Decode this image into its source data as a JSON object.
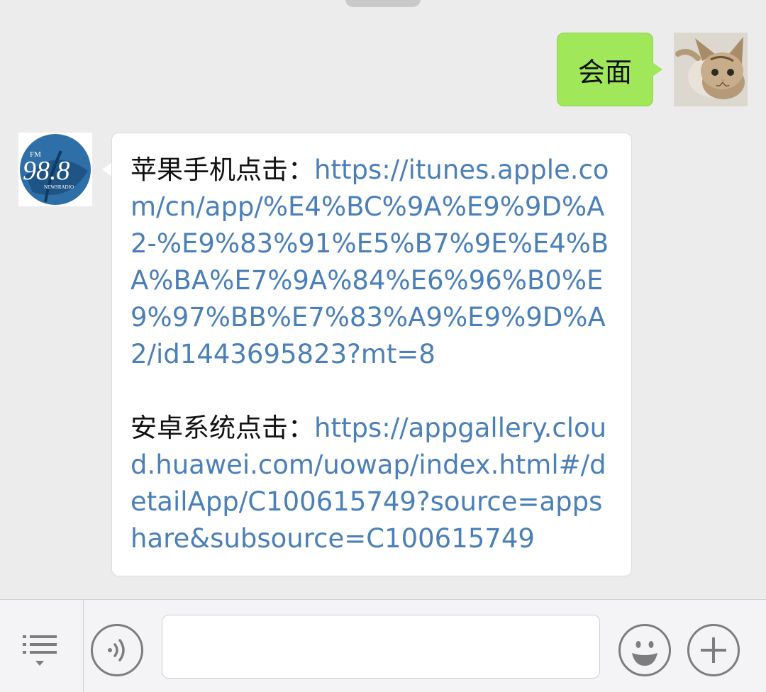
{
  "colors": {
    "chat_background": "#ececec",
    "outgoing_bubble": "#a0e75a",
    "incoming_bubble": "#ffffff",
    "link": "#4a7fb8",
    "icon_stroke": "#7d7d7f"
  },
  "outgoing_message": {
    "text": "会面",
    "avatar_icon": "cat-avatar-icon"
  },
  "incoming_message": {
    "avatar_icon": "radio-98-8-logo-icon",
    "avatar_text": {
      "band": "FM",
      "frequency": "98.8",
      "tagline": "NEWSRADIO"
    },
    "paragraphs": [
      {
        "label": "苹果手机点击：",
        "link": "https://itunes.apple.com/cn/app/%E4%BC%9A%E9%9D%A2-%E9%83%91%E5%B7%9E%E4%BA%BA%E7%9A%84%E6%96%B0%E9%97%BB%E7%83%A9%E9%9D%A2/id1443695823?mt=8"
      },
      {
        "label": "安卓系统点击：",
        "link": "https://appgallery.cloud.huawei.com/uowap/index.html#/detailApp/C100615749?source=appshare&subsource=C100615749"
      }
    ]
  },
  "input_bar": {
    "menu_icon": "menu-list-icon",
    "voice_icon": "voice-icon",
    "text_value": "",
    "emoji_icon": "emoji-smile-icon",
    "plus_icon": "plus-icon"
  }
}
